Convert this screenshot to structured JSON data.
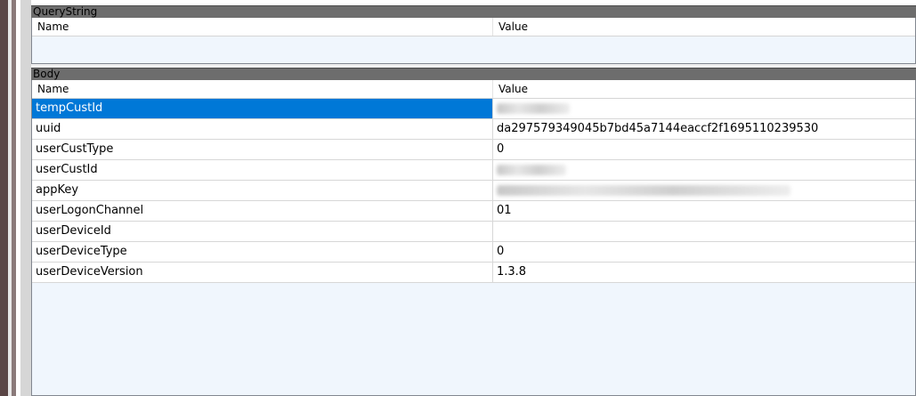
{
  "querystring": {
    "title": "QueryString",
    "columns": {
      "name": "Name",
      "value": "Value"
    }
  },
  "body": {
    "title": "Body",
    "columns": {
      "name": "Name",
      "value": "Value"
    },
    "rows": [
      {
        "name": "tempCustId",
        "value": "",
        "redacted": true
      },
      {
        "name": "uuid",
        "value": "da297579349045b7bd45a7144eaccf2f1695110239530"
      },
      {
        "name": "userCustType",
        "value": "0"
      },
      {
        "name": "userCustId",
        "value": "",
        "redacted": true
      },
      {
        "name": "appKey",
        "value": "",
        "redacted": true
      },
      {
        "name": "userLogonChannel",
        "value": "01"
      },
      {
        "name": "userDeviceId",
        "value": ""
      },
      {
        "name": "userDeviceType",
        "value": "0"
      },
      {
        "name": "userDeviceVersion",
        "value": "1.3.8"
      }
    ]
  },
  "colors": {
    "selection": "#0078d7",
    "list_background": "#f0f6fd",
    "group_header": "#6d6d6d"
  }
}
